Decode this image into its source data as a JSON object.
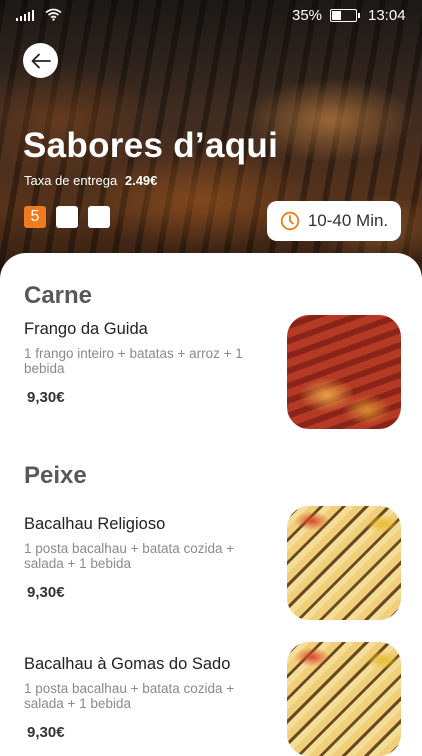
{
  "status_bar": {
    "battery": "35%",
    "time": "13:04"
  },
  "restaurant": {
    "name": "Sabores d’aqui",
    "fee_label": "Taxa de entrega",
    "fee_value": "2.49€",
    "rating": "5",
    "delivery_time": "10-40 Min."
  },
  "sections": [
    {
      "title": "Carne",
      "dishes": [
        {
          "name": "Frango da Guida",
          "desc": "1 frango inteiro + batatas + arroz + 1 bebida",
          "price": "9,30€"
        }
      ]
    },
    {
      "title": "Peixe",
      "dishes": [
        {
          "name": "Bacalhau Religioso",
          "desc": "1 posta bacalhau + batata cozida + salada + 1 bebida",
          "price": "9,30€"
        },
        {
          "name": "Bacalhau à Gomas do Sado",
          "desc": "1 posta bacalhau + batata cozida + salada + 1 bebida",
          "price": "9,30€"
        }
      ]
    }
  ],
  "colors": {
    "accent": "#f07c22",
    "section_title": "#585858"
  }
}
